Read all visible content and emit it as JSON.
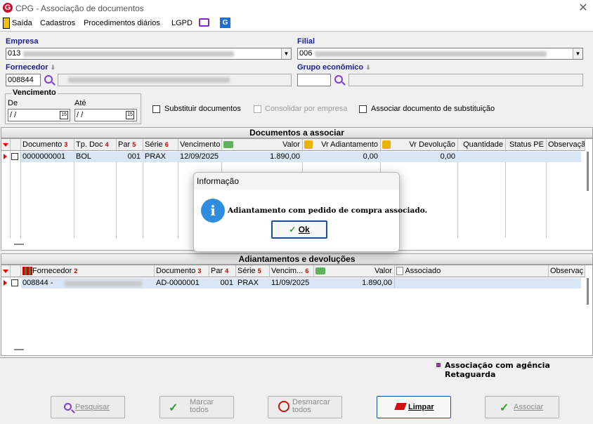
{
  "window": {
    "title": "CPG - Associação de documentos",
    "close": "✕"
  },
  "menu": {
    "items": [
      "Saída",
      "Cadastros",
      "Procedimentos diários",
      "LGPD"
    ]
  },
  "form": {
    "empresa_label": "Empresa",
    "empresa_value": "013",
    "filial_label": "Filial",
    "filial_value": "006",
    "fornecedor_label": "Fornecedor",
    "fornecedor_value": "008844",
    "grupo_label": "Grupo econômico",
    "grupo_value": "",
    "vencimento_label": "Vencimento",
    "de_label": "De",
    "ate_label": "Até",
    "de_value": " / /",
    "ate_value": " / /",
    "cal_glyph": "15",
    "chk_substituir": "Substituir documentos",
    "chk_consolidar": "Consolidar por empresa",
    "chk_associar": "Associar documento de substituição"
  },
  "grid1": {
    "title": "Documentos a associar",
    "columns": [
      {
        "label": "Documento",
        "sort": "3"
      },
      {
        "label": "Tp. Doc",
        "sort": "4"
      },
      {
        "label": "Par",
        "sort": "5"
      },
      {
        "label": "Série",
        "sort": "6"
      },
      {
        "label": "Vencimento",
        "sort": ""
      },
      {
        "label": "Valor",
        "sort": ""
      },
      {
        "label": "Vr Adiantamento",
        "sort": ""
      },
      {
        "label": "Vr Devolução",
        "sort": ""
      },
      {
        "label": "Quantidade",
        "sort": ""
      },
      {
        "label": "Status PE",
        "sort": ""
      },
      {
        "label": "Observaçã",
        "sort": ""
      }
    ],
    "row": {
      "documento": "0000000001",
      "tp_doc": "BOL",
      "par": "001",
      "serie": "PRAX",
      "vencimento": "12/09/2025",
      "valor": "1.890,00",
      "vr_adiantamento": "0,00",
      "vr_devolucao": "0,00"
    }
  },
  "grid2": {
    "title": "Adiantamentos e devoluções",
    "columns": [
      {
        "label": "Fornecedor",
        "sort": "2"
      },
      {
        "label": "Documento",
        "sort": "3"
      },
      {
        "label": "Par",
        "sort": "4"
      },
      {
        "label": "Série",
        "sort": "5"
      },
      {
        "label": "Vencim...",
        "sort": "6"
      },
      {
        "label": "Valor",
        "sort": ""
      },
      {
        "label": "Associado",
        "sort": ""
      },
      {
        "label": "Observaç",
        "sort": ""
      }
    ],
    "row": {
      "fornecedor": "008844 -",
      "documento": "AD-0000001",
      "par": "001",
      "serie": "PRAX",
      "vencimento": "11/09/2025",
      "valor": "1.890,00"
    }
  },
  "legend": {
    "text": "Associação com agência Retaguarda",
    "color": "#8e3a9a"
  },
  "buttons": {
    "pesquisar": "Pesquisar",
    "marcar": "Marcar todos",
    "desmarcar": "Desmarcar todos",
    "limpar": "Limpar",
    "associar": "Associar"
  },
  "dialog": {
    "title": "Informação",
    "message": "Adiantamento com pedido de compra associado.",
    "ok": "Ok",
    "icon": "i"
  },
  "colors": {
    "accent": "#1a1a9c",
    "selection": "#d8e6f5",
    "info": "#2f8de0"
  }
}
